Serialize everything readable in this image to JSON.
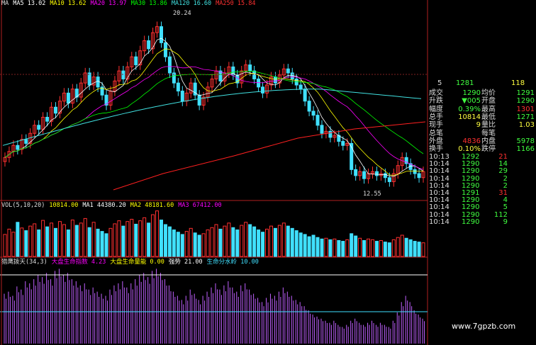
{
  "colors": {
    "up": "#ff3030",
    "down": "#40e0ff",
    "bg": "#000000",
    "ma5": "#ffffff",
    "ma10": "#ffff00",
    "ma20": "#ff00ff",
    "ma30": "#00ff00",
    "ma120": "#40e0e0",
    "ma250": "#ff2020",
    "purple": "#c060ff"
  },
  "ma_legend": [
    {
      "text": "MA",
      "color": "#dddddd"
    },
    {
      "text": "MA5 13.02",
      "color": "#ffffff"
    },
    {
      "text": "MA10 13.62",
      "color": "#ffff00"
    },
    {
      "text": "MA20 13.97",
      "color": "#ff00ff"
    },
    {
      "text": "MA30 13.86",
      "color": "#00ff00"
    },
    {
      "text": "MA120 16.60",
      "color": "#40e0e0"
    },
    {
      "text": "MA250 15.84",
      "color": "#ff3030"
    }
  ],
  "price_labels": {
    "high": "20.24",
    "low": "12.55"
  },
  "vol_legend": [
    {
      "text": "VOL(5,10,20)",
      "color": "#dddddd"
    },
    {
      "text": "10814.00",
      "color": "#ffff00"
    },
    {
      "text": "MA1 44380.20",
      "color": "#ffffff"
    },
    {
      "text": "MA2 48181.60",
      "color": "#ffff00"
    },
    {
      "text": "MA3 67412.00",
      "color": "#ff00ff"
    }
  ],
  "ind_legend": [
    {
      "text": "猎鹰拨天(34,3)",
      "color": "#dddddd"
    },
    {
      "text": "大盘生命指数 4.23",
      "color": "#ff00ff"
    },
    {
      "text": "大盘生命量能 0.00",
      "color": "#ffff00"
    },
    {
      "text": "强势 21.00",
      "color": "#ffffff"
    },
    {
      "text": "生命分水岭 10.00",
      "color": "#40e0ff"
    }
  ],
  "quote_top": {
    "a": "5",
    "b": "1281",
    "c": "118"
  },
  "quote_rows": [
    {
      "l1": "成交",
      "v1": "1290",
      "l2": "均价",
      "v2": "1291",
      "c1": "#40ff40",
      "c2": "#40ff40"
    },
    {
      "l1": "升跌",
      "v1": "▼005",
      "l2": "开盘",
      "v2": "1290",
      "c1": "#40ff40",
      "c2": "#40ff40"
    },
    {
      "l1": "幅度",
      "v1": "0.39%",
      "l2": "最高",
      "v2": "1301",
      "c1": "#40ff40",
      "c2": "#ff3030"
    },
    {
      "l1": "总手",
      "v1": "10814",
      "l2": "最低",
      "v2": "1271",
      "c1": "#ffff40",
      "c2": "#40ff40"
    },
    {
      "l1": "现手",
      "v1": "9",
      "l2": "量比",
      "v2": "1.03",
      "c1": "#ffff40",
      "c2": "#ffff40"
    },
    {
      "l1": "总笔",
      "v1": "",
      "l2": "每笔",
      "v2": "",
      "c1": "#dddddd",
      "c2": "#dddddd"
    },
    {
      "l1": "外盘",
      "v1": "4836",
      "l2": "内盘",
      "v2": "5978",
      "c1": "#ff3030",
      "c2": "#40ff40"
    },
    {
      "l1": "换手",
      "v1": "0.10%",
      "l2": "跌停",
      "v2": "1166",
      "c1": "#ffff40",
      "c2": "#40ff40"
    }
  ],
  "ticks": [
    {
      "time": "10:13",
      "price": "1292",
      "vol": "21",
      "pc": "#40ff40",
      "vc": "#ff3030"
    },
    {
      "time": "10:14",
      "price": "1290",
      "vol": "14",
      "pc": "#40ff40",
      "vc": "#40ff40"
    },
    {
      "time": "10:14",
      "price": "1290",
      "vol": "29",
      "pc": "#40ff40",
      "vc": "#40ff40"
    },
    {
      "time": "10:14",
      "price": "1290",
      "vol": "2",
      "pc": "#40ff40",
      "vc": "#40ff40"
    },
    {
      "time": "10:14",
      "price": "1290",
      "vol": "2",
      "pc": "#40ff40",
      "vc": "#40ff40"
    },
    {
      "time": "10:14",
      "price": "1291",
      "vol": "31",
      "pc": "#40ff40",
      "vc": "#ff3030"
    },
    {
      "time": "10:14",
      "price": "1290",
      "vol": "4",
      "pc": "#40ff40",
      "vc": "#40ff40"
    },
    {
      "time": "10:14",
      "price": "1290",
      "vol": "5",
      "pc": "#40ff40",
      "vc": "#40ff40"
    },
    {
      "time": "10:14",
      "price": "1290",
      "vol": "112",
      "pc": "#40ff40",
      "vc": "#40ff40"
    },
    {
      "time": "10:14",
      "price": "1290",
      "vol": "9",
      "pc": "#40ff40",
      "vc": "#40ff40"
    }
  ],
  "watermark": "www.7gpzb.com",
  "chart_data": {
    "type": "candlestick",
    "closes": [
      13.6,
      13.9,
      14.2,
      14.0,
      14.5,
      14.3,
      14.8,
      15.2,
      15.0,
      15.6,
      15.4,
      16.1,
      15.8,
      16.4,
      16.8,
      16.3,
      17.0,
      16.6,
      17.3,
      17.8,
      17.2,
      17.6,
      17.1,
      16.7,
      16.2,
      16.9,
      17.4,
      17.9,
      17.5,
      18.1,
      18.6,
      18.2,
      18.9,
      19.4,
      19.0,
      19.8,
      20.1,
      19.3,
      18.6,
      17.8,
      17.3,
      16.9,
      16.4,
      16.8,
      17.3,
      16.7,
      16.2,
      16.6,
      17.1,
      17.5,
      17.9,
      17.4,
      17.8,
      18.1,
      17.7,
      17.3,
      17.9,
      18.2,
      17.9,
      17.5,
      17.1,
      16.8,
      17.2,
      17.6,
      17.3,
      17.7,
      18.0,
      17.8,
      17.5,
      17.2,
      17.0,
      16.4,
      15.9,
      15.7,
      15.2,
      14.8,
      14.9,
      14.6,
      14.7,
      14.4,
      14.2,
      14.3,
      13.0,
      12.7,
      12.9,
      12.55,
      12.8,
      12.9,
      12.7,
      12.8,
      12.6,
      12.4,
      12.8,
      13.2,
      13.6,
      13.3,
      13.0,
      12.8,
      12.6,
      12.9
    ],
    "vol": [
      58,
      72,
      64,
      90,
      75,
      68,
      80,
      86,
      70,
      95,
      78,
      88,
      74,
      92,
      84,
      70,
      96,
      82,
      88,
      100,
      76,
      90,
      72,
      66,
      60,
      74,
      86,
      94,
      80,
      92,
      98,
      85,
      94,
      102,
      88,
      110,
      120,
      96,
      84,
      78,
      70,
      64,
      58,
      66,
      74,
      62,
      56,
      60,
      70,
      76,
      84,
      72,
      80,
      88,
      76,
      70,
      82,
      90,
      84,
      78,
      70,
      64,
      72,
      80,
      74,
      82,
      88,
      80,
      74,
      68,
      62,
      58,
      52,
      56,
      50,
      46,
      48,
      44,
      46,
      42,
      40,
      44,
      60,
      54,
      48,
      42,
      46,
      44,
      40,
      42,
      38,
      36,
      44,
      50,
      56,
      48,
      44,
      40,
      38,
      36
    ],
    "ind": [
      48,
      50,
      46,
      55,
      52,
      60,
      58,
      62,
      66,
      64,
      68,
      62,
      70,
      72,
      66,
      68,
      62,
      60,
      56,
      58,
      52,
      54,
      50,
      48,
      46,
      52,
      56,
      58,
      60,
      54,
      58,
      62,
      66,
      68,
      64,
      70,
      72,
      68,
      62,
      56,
      50,
      46,
      42,
      46,
      52,
      48,
      42,
      46,
      50,
      54,
      58,
      52,
      56,
      60,
      54,
      50,
      56,
      58,
      52,
      48,
      44,
      40,
      44,
      48,
      46,
      50,
      54,
      50,
      46,
      42,
      40,
      36,
      32,
      28,
      26,
      24,
      22,
      20,
      22,
      18,
      16,
      18,
      22,
      24,
      20,
      18,
      20,
      22,
      18,
      20,
      18,
      16,
      22,
      30,
      40,
      46,
      40,
      32,
      28,
      24
    ],
    "price_ylim": [
      11.5,
      21.0
    ]
  }
}
